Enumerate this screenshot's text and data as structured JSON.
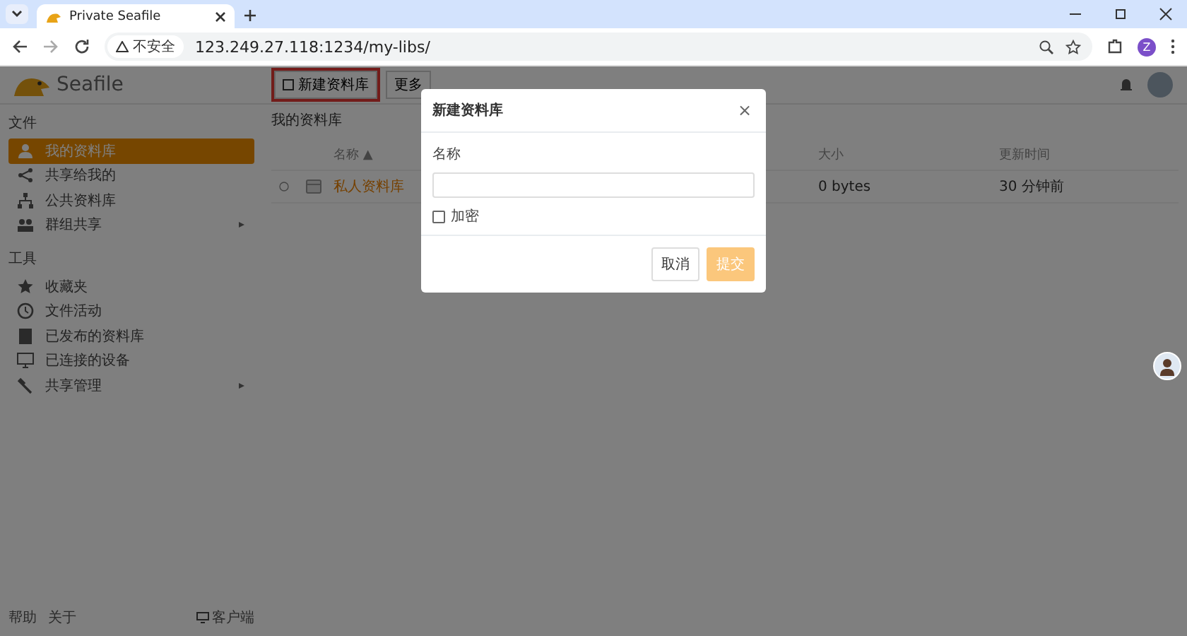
{
  "browser": {
    "tab_title": "Private Seafile",
    "security": "不安全",
    "url": "123.249.27.118:1234/my-libs/",
    "profile_initial": "Z"
  },
  "header": {
    "logo_text": "Seafile",
    "toolbar": [
      {
        "label": "新建资料库",
        "highlighted": true
      },
      {
        "label": "更多",
        "highlighted": false
      }
    ]
  },
  "sidebar": {
    "sections": [
      {
        "title": "文件",
        "items": [
          {
            "label": "我的资料库",
            "selected": true,
            "has_caret": false
          },
          {
            "label": "共享给我的",
            "selected": false,
            "has_caret": false
          },
          {
            "label": "公共资料库",
            "selected": false,
            "has_caret": false
          },
          {
            "label": "群组共享",
            "selected": false,
            "has_caret": true
          }
        ]
      },
      {
        "title": "工具",
        "items": [
          {
            "label": "收藏夹",
            "selected": false,
            "has_caret": false
          },
          {
            "label": "文件活动",
            "selected": false,
            "has_caret": false
          },
          {
            "label": "已发布的资料库",
            "selected": false,
            "has_caret": false
          },
          {
            "label": "已连接的设备",
            "selected": false,
            "has_caret": false
          },
          {
            "label": "共享管理",
            "selected": false,
            "has_caret": true
          }
        ]
      }
    ],
    "footer": {
      "links": [
        "帮助",
        "关于"
      ],
      "client": "客户端"
    }
  },
  "content": {
    "title": "我的资料库",
    "columns": [
      "名称 ▲",
      "大小",
      "更新时间"
    ],
    "rows": [
      {
        "name": "私人资料库",
        "size": "0 bytes",
        "updated": "30 分钟前"
      }
    ]
  },
  "dialog": {
    "title": "新建资料库",
    "close": "×",
    "field_label": "名称",
    "checkbox": {
      "label": "加密",
      "checked": false
    },
    "buttons": [
      {
        "label": "取消",
        "kind": "secondary",
        "disabled": false
      },
      {
        "label": "提交",
        "kind": "primary",
        "disabled": true
      }
    ]
  }
}
